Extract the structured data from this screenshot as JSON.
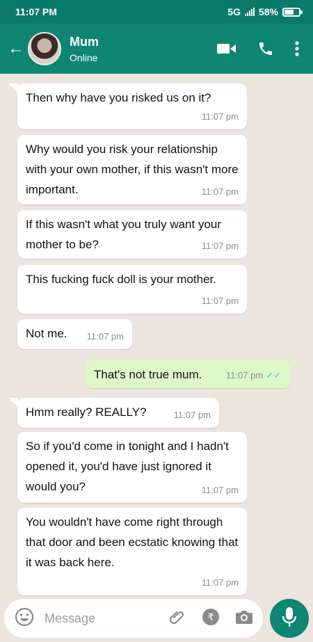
{
  "status_bar": {
    "time": "11:07 PM",
    "network": "5G",
    "battery": "58%",
    "battery_level": 0.58
  },
  "header": {
    "contact_name": "Mum",
    "contact_status": "Online",
    "icons": [
      "back-arrow-icon",
      "video-call-icon",
      "phone-icon",
      "more-options-icon"
    ]
  },
  "messages": [
    {
      "dir": "in",
      "text": "Then why have you risked us on it?",
      "time": "11:07 pm"
    },
    {
      "dir": "in",
      "text": "Why would you risk your relationship with your own mother, if this wasn't more important.",
      "time": "11:07 pm"
    },
    {
      "dir": "in",
      "text": "If this wasn't what you truly want your mother to be?",
      "time": "11:07 pm"
    },
    {
      "dir": "in",
      "text": "This  fucking  fuck doll is your mother.",
      "time": "11:07 pm"
    },
    {
      "dir": "in",
      "text": "Not me.",
      "time": "11:07 pm"
    },
    {
      "dir": "out",
      "text": "That's not true mum.",
      "time": "11:07 pm",
      "read": true
    },
    {
      "dir": "in",
      "text": "Hmm really? REALLY?",
      "time": "11:07 pm"
    },
    {
      "dir": "in",
      "text": "So if you'd come in tonight and I hadn't opened it, you'd have just ignored it would you?",
      "time": "11:07 pm"
    },
    {
      "dir": "in",
      "text": "You wouldn't have come right through that door and been ecstatic knowing that it was back here.",
      "time": "11:07 pm"
    }
  ],
  "composer": {
    "placeholder": "Message",
    "icons": [
      "emoji-icon",
      "attach-icon",
      "rupee-payment-icon",
      "camera-icon",
      "microphone-icon"
    ]
  },
  "colors": {
    "header": "#0f8573",
    "incoming_bubble": "#ffffff",
    "outgoing_bubble": "#dcf8c6",
    "read_ticks": "#4fb6ec",
    "chat_background": "#ece5dd"
  }
}
